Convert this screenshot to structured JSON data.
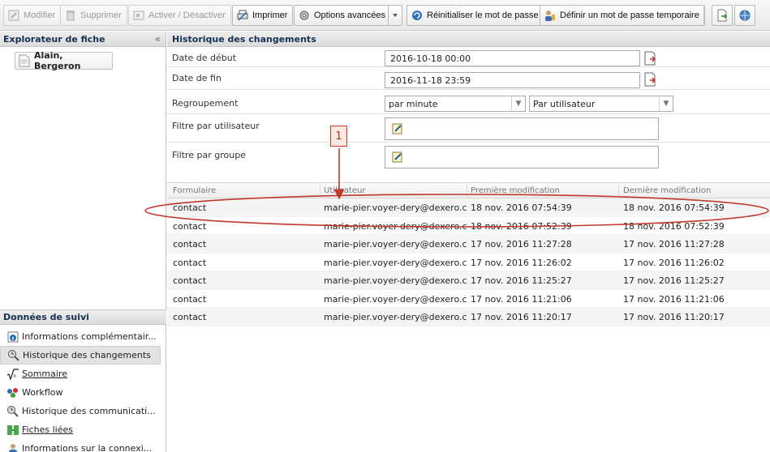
{
  "toolbar": {
    "buttons": [
      {
        "label": "Modifier",
        "icon": "edit-icon",
        "enabled": false
      },
      {
        "label": "Supprimer",
        "icon": "trash-icon",
        "enabled": false
      },
      {
        "label": "Activer / Désactiver",
        "icon": "toggle-icon",
        "enabled": false
      },
      {
        "label": "Imprimer",
        "icon": "print-icon",
        "enabled": true
      },
      {
        "label": "Options avancées",
        "icon": "gear-icon",
        "enabled": true
      },
      {
        "label": "Réinitialiser le mot de passe",
        "icon": "reset-password-icon",
        "enabled": true
      },
      {
        "label": "Définir un mot de passe temporaire",
        "icon": "temporary-password-icon",
        "enabled": true
      }
    ]
  },
  "record_explorer": {
    "title": "Explorateur de fiche",
    "collapse_glyph": "«",
    "record": "Alain, Bergeron"
  },
  "tracking": {
    "title": "Données de suivi",
    "items": [
      {
        "label": "Informations complémentair...",
        "icon": "info-icon"
      },
      {
        "label": "Historique des changements",
        "icon": "history-icon",
        "selected": true
      },
      {
        "label": "Sommaire",
        "icon": "summary-icon",
        "underline": "S"
      },
      {
        "label": "Workflow",
        "icon": "workflow-icon",
        "underline": "w"
      },
      {
        "label": "Historique des communicati...",
        "icon": "history-icon"
      },
      {
        "label": "Fiches liées",
        "icon": "linked-records-icon",
        "underline": "l"
      },
      {
        "label": "Informations sur la connexi...",
        "icon": "user-icon"
      }
    ]
  },
  "history": {
    "title": "Historique des changements",
    "start_label": "Date de début",
    "start_value": "2016-10-18 00:00",
    "end_label": "Date de fin",
    "end_value": "2016-11-18 23:59",
    "grouping_label": "Regroupement",
    "grouping_value": "par minute",
    "grouping_by": "Par utilisateur",
    "user_filter_label": "Filtre par utilisateur",
    "group_filter_label": "Filtre par groupe"
  },
  "table": {
    "columns": [
      "Formulaire",
      "Utilisateur",
      "Première modification",
      "Dernière modification"
    ],
    "rows": [
      [
        "contact",
        "marie-pier.voyer-dery@dexero.c",
        "18 nov. 2016 07:54:39",
        "18 nov. 2016 07:54:39"
      ],
      [
        "contact",
        "marie-pier.voyer-dery@dexero.c",
        "18 nov. 2016 07:52:39",
        "18 nov. 2016 07:52:39"
      ],
      [
        "contact",
        "marie-pier.voyer-dery@dexero.c",
        "17 nov. 2016 11:27:28",
        "17 nov. 2016 11:27:28"
      ],
      [
        "contact",
        "marie-pier.voyer-dery@dexero.c",
        "17 nov. 2016 11:26:02",
        "17 nov. 2016 11:26:02"
      ],
      [
        "contact",
        "marie-pier.voyer-dery@dexero.c",
        "17 nov. 2016 11:25:27",
        "17 nov. 2016 11:25:27"
      ],
      [
        "contact",
        "marie-pier.voyer-dery@dexero.c",
        "17 nov. 2016 11:21:06",
        "17 nov. 2016 11:21:06"
      ],
      [
        "contact",
        "marie-pier.voyer-dery@dexero.c",
        "17 nov. 2016 11:20:17",
        "17 nov. 2016 11:20:17"
      ]
    ]
  },
  "annotation": {
    "callout_number": "1",
    "color": "#c0392b"
  }
}
